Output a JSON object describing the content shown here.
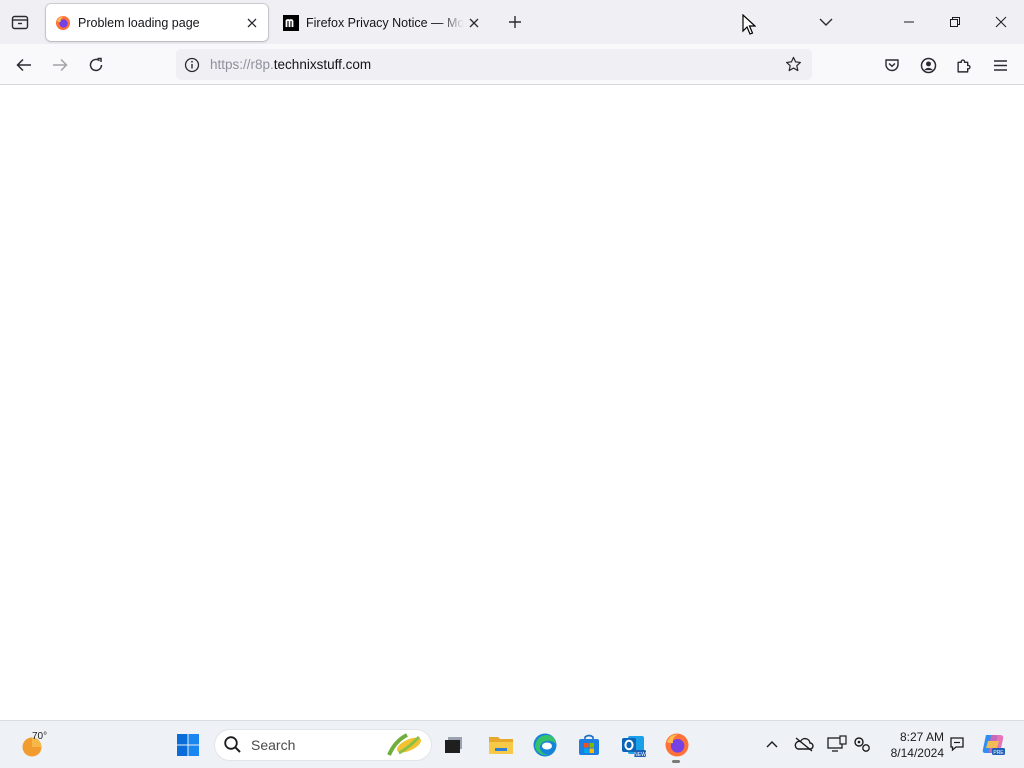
{
  "browser": {
    "tabs": [
      {
        "title": "Problem loading page",
        "active": true,
        "icon": "firefox-icon"
      },
      {
        "title": "Firefox Privacy Notice — Mozilla",
        "active": false,
        "icon": "mozilla-m-icon"
      }
    ],
    "url": {
      "scheme_and_subdomain": "https://r8p.",
      "host": "technixstuff.com"
    },
    "icons": {
      "tab_list": "tab-list-icon",
      "new_tab": "plus-icon",
      "list_all_tabs": "chevron-down-icon",
      "minimize": "minimize-icon",
      "restore": "restore-icon",
      "close": "close-icon",
      "back": "back-arrow-icon",
      "forward": "forward-arrow-icon",
      "reload": "reload-icon",
      "site_info": "info-icon",
      "bookmark": "star-icon",
      "pocket": "pocket-icon",
      "account": "account-icon",
      "extensions": "puzzle-icon",
      "menu": "hamburger-menu-icon"
    }
  },
  "taskbar": {
    "weather_temp": "70°",
    "search_placeholder": "Search",
    "apps": [
      "start-icon",
      "search-icon",
      "task-view-icon",
      "file-explorer-icon",
      "edge-icon",
      "store-icon",
      "outlook-icon",
      "firefox-icon"
    ],
    "tray": [
      "chevron-up-icon",
      "onedrive-icon",
      "display-icon",
      "settings-gears-icon",
      "notification-icon",
      "copilot-icon"
    ],
    "time": "8:27 AM",
    "date": "8/14/2024"
  },
  "colors": {
    "tabstrip_bg": "#f0f0f4",
    "navbar_bg": "#f9f9fb",
    "urlbar_bg": "#f0f0f4",
    "taskbar_bg": "#eef1f6",
    "windows_blue": "#0a6cd8"
  }
}
